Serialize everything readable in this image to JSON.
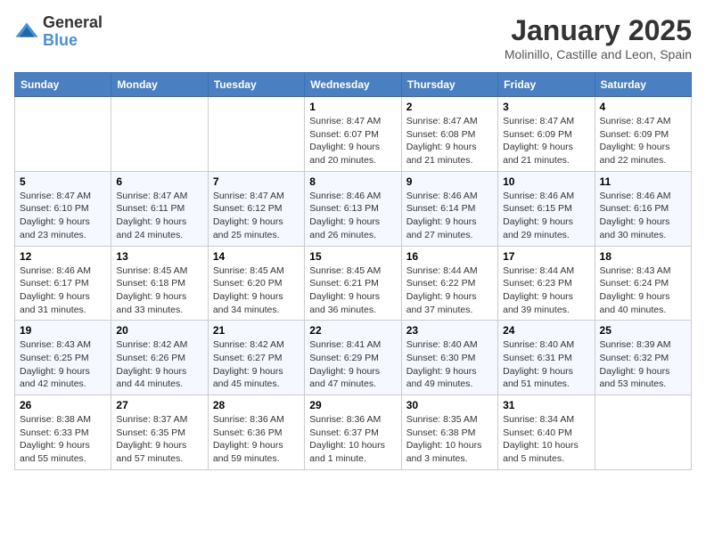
{
  "logo": {
    "text_general": "General",
    "text_blue": "Blue"
  },
  "header": {
    "month_year": "January 2025",
    "location": "Molinillo, Castille and Leon, Spain"
  },
  "weekdays": [
    "Sunday",
    "Monday",
    "Tuesday",
    "Wednesday",
    "Thursday",
    "Friday",
    "Saturday"
  ],
  "weeks": [
    [
      {
        "day": "",
        "info": ""
      },
      {
        "day": "",
        "info": ""
      },
      {
        "day": "",
        "info": ""
      },
      {
        "day": "1",
        "info": "Sunrise: 8:47 AM\nSunset: 6:07 PM\nDaylight: 9 hours and 20 minutes."
      },
      {
        "day": "2",
        "info": "Sunrise: 8:47 AM\nSunset: 6:08 PM\nDaylight: 9 hours and 21 minutes."
      },
      {
        "day": "3",
        "info": "Sunrise: 8:47 AM\nSunset: 6:09 PM\nDaylight: 9 hours and 21 minutes."
      },
      {
        "day": "4",
        "info": "Sunrise: 8:47 AM\nSunset: 6:09 PM\nDaylight: 9 hours and 22 minutes."
      }
    ],
    [
      {
        "day": "5",
        "info": "Sunrise: 8:47 AM\nSunset: 6:10 PM\nDaylight: 9 hours and 23 minutes."
      },
      {
        "day": "6",
        "info": "Sunrise: 8:47 AM\nSunset: 6:11 PM\nDaylight: 9 hours and 24 minutes."
      },
      {
        "day": "7",
        "info": "Sunrise: 8:47 AM\nSunset: 6:12 PM\nDaylight: 9 hours and 25 minutes."
      },
      {
        "day": "8",
        "info": "Sunrise: 8:46 AM\nSunset: 6:13 PM\nDaylight: 9 hours and 26 minutes."
      },
      {
        "day": "9",
        "info": "Sunrise: 8:46 AM\nSunset: 6:14 PM\nDaylight: 9 hours and 27 minutes."
      },
      {
        "day": "10",
        "info": "Sunrise: 8:46 AM\nSunset: 6:15 PM\nDaylight: 9 hours and 29 minutes."
      },
      {
        "day": "11",
        "info": "Sunrise: 8:46 AM\nSunset: 6:16 PM\nDaylight: 9 hours and 30 minutes."
      }
    ],
    [
      {
        "day": "12",
        "info": "Sunrise: 8:46 AM\nSunset: 6:17 PM\nDaylight: 9 hours and 31 minutes."
      },
      {
        "day": "13",
        "info": "Sunrise: 8:45 AM\nSunset: 6:18 PM\nDaylight: 9 hours and 33 minutes."
      },
      {
        "day": "14",
        "info": "Sunrise: 8:45 AM\nSunset: 6:20 PM\nDaylight: 9 hours and 34 minutes."
      },
      {
        "day": "15",
        "info": "Sunrise: 8:45 AM\nSunset: 6:21 PM\nDaylight: 9 hours and 36 minutes."
      },
      {
        "day": "16",
        "info": "Sunrise: 8:44 AM\nSunset: 6:22 PM\nDaylight: 9 hours and 37 minutes."
      },
      {
        "day": "17",
        "info": "Sunrise: 8:44 AM\nSunset: 6:23 PM\nDaylight: 9 hours and 39 minutes."
      },
      {
        "day": "18",
        "info": "Sunrise: 8:43 AM\nSunset: 6:24 PM\nDaylight: 9 hours and 40 minutes."
      }
    ],
    [
      {
        "day": "19",
        "info": "Sunrise: 8:43 AM\nSunset: 6:25 PM\nDaylight: 9 hours and 42 minutes."
      },
      {
        "day": "20",
        "info": "Sunrise: 8:42 AM\nSunset: 6:26 PM\nDaylight: 9 hours and 44 minutes."
      },
      {
        "day": "21",
        "info": "Sunrise: 8:42 AM\nSunset: 6:27 PM\nDaylight: 9 hours and 45 minutes."
      },
      {
        "day": "22",
        "info": "Sunrise: 8:41 AM\nSunset: 6:29 PM\nDaylight: 9 hours and 47 minutes."
      },
      {
        "day": "23",
        "info": "Sunrise: 8:40 AM\nSunset: 6:30 PM\nDaylight: 9 hours and 49 minutes."
      },
      {
        "day": "24",
        "info": "Sunrise: 8:40 AM\nSunset: 6:31 PM\nDaylight: 9 hours and 51 minutes."
      },
      {
        "day": "25",
        "info": "Sunrise: 8:39 AM\nSunset: 6:32 PM\nDaylight: 9 hours and 53 minutes."
      }
    ],
    [
      {
        "day": "26",
        "info": "Sunrise: 8:38 AM\nSunset: 6:33 PM\nDaylight: 9 hours and 55 minutes."
      },
      {
        "day": "27",
        "info": "Sunrise: 8:37 AM\nSunset: 6:35 PM\nDaylight: 9 hours and 57 minutes."
      },
      {
        "day": "28",
        "info": "Sunrise: 8:36 AM\nSunset: 6:36 PM\nDaylight: 9 hours and 59 minutes."
      },
      {
        "day": "29",
        "info": "Sunrise: 8:36 AM\nSunset: 6:37 PM\nDaylight: 10 hours and 1 minute."
      },
      {
        "day": "30",
        "info": "Sunrise: 8:35 AM\nSunset: 6:38 PM\nDaylight: 10 hours and 3 minutes."
      },
      {
        "day": "31",
        "info": "Sunrise: 8:34 AM\nSunset: 6:40 PM\nDaylight: 10 hours and 5 minutes."
      },
      {
        "day": "",
        "info": ""
      }
    ]
  ]
}
